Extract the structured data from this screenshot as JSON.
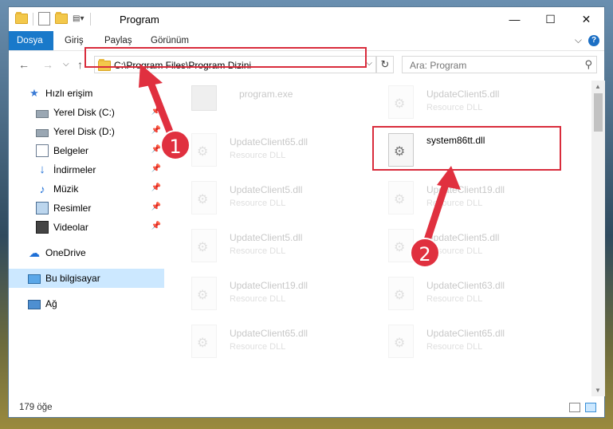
{
  "window": {
    "title": "Program",
    "minimize": "—",
    "maximize": "☐",
    "close": "✕"
  },
  "ribbon": {
    "tabs": [
      {
        "label": "Dosya",
        "active": true
      },
      {
        "label": "Giriş"
      },
      {
        "label": "Paylaş"
      },
      {
        "label": "Görünüm"
      }
    ],
    "collapse": "⌵",
    "help": "?"
  },
  "nav": {
    "back": "←",
    "forward": "→",
    "recent": "⌵",
    "up": "↑",
    "address": "C:\\Program Files\\Program Dizini",
    "address_chevron": "⌵",
    "refresh": "↻",
    "search_placeholder": "Ara: Program",
    "search_icon": "⚲"
  },
  "sidebar": {
    "items": [
      {
        "label": "Hızlı erişim",
        "icon": "star-icon"
      },
      {
        "label": "Yerel Disk (C:)",
        "icon": "drive-icon",
        "pinned": true
      },
      {
        "label": "Yerel Disk (D:)",
        "icon": "drive-icon",
        "pinned": true
      },
      {
        "label": "Belgeler",
        "icon": "documents-icon",
        "pinned": true
      },
      {
        "label": "İndirmeler",
        "icon": "download-icon",
        "pinned": true
      },
      {
        "label": "Müzik",
        "icon": "music-icon",
        "pinned": true
      },
      {
        "label": "Resimler",
        "icon": "pictures-icon",
        "pinned": true
      },
      {
        "label": "Videolar",
        "icon": "videos-icon",
        "pinned": true
      },
      {
        "label": "OneDrive",
        "icon": "cloud-icon"
      },
      {
        "label": "Bu bilgisayar",
        "icon": "computer-icon",
        "selected": true
      },
      {
        "label": "Ağ",
        "icon": "network-icon"
      }
    ],
    "pin_glyph": "📌"
  },
  "files": [
    {
      "name": "program.exe",
      "type": "",
      "kind": "exe",
      "faded": true
    },
    {
      "name": "UpdateClient5.dll",
      "type": "Resource DLL",
      "faded": true
    },
    {
      "name": "UpdateClient65.dll",
      "type": "Resource DLL",
      "faded": true
    },
    {
      "name": "system86tt.dll",
      "type": "",
      "faded": false
    },
    {
      "name": "UpdateClient5.dll",
      "type": "Resource DLL",
      "faded": true
    },
    {
      "name": "UpdateClient19.dll",
      "type": "Resource DLL",
      "faded": true
    },
    {
      "name": "UpdateClient5.dll",
      "type": "Resource DLL",
      "faded": true
    },
    {
      "name": "UpdateClient5.dll",
      "type": "Resource DLL",
      "faded": true
    },
    {
      "name": "UpdateClient19.dll",
      "type": "Resource DLL",
      "faded": true
    },
    {
      "name": "UpdateClient63.dll",
      "type": "Resource DLL",
      "faded": true
    },
    {
      "name": "UpdateClient65.dll",
      "type": "Resource DLL",
      "faded": true
    },
    {
      "name": "UpdateClient65.dll",
      "type": "Resource DLL",
      "faded": true
    }
  ],
  "status": {
    "count": "179 öğe"
  },
  "callouts": [
    "1",
    "2"
  ],
  "colors": {
    "accent": "#1979ca",
    "callout": "#e0303f",
    "selected": "#cce8ff"
  }
}
